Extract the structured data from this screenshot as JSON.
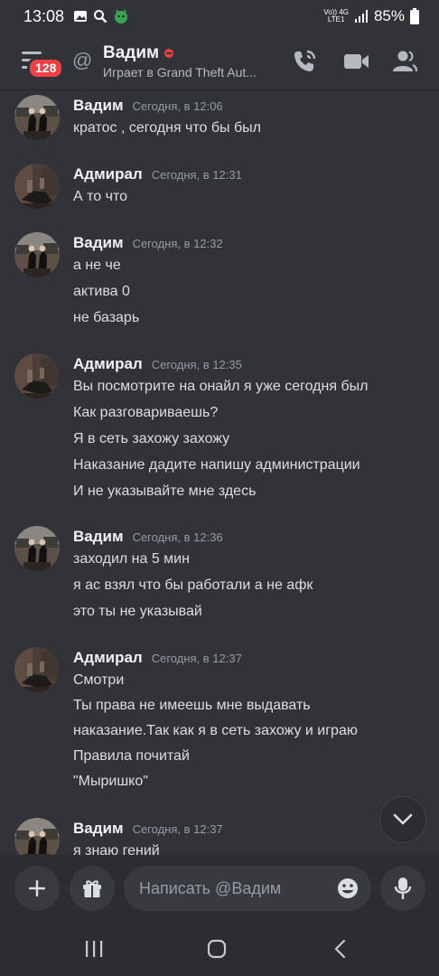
{
  "status_bar": {
    "time": "13:08",
    "network_top": "Vo)) 4G",
    "network_bottom": "LTE1",
    "battery": "85%"
  },
  "header": {
    "unread_badge": "128",
    "title": "Вадим",
    "activity": "Играет в Grand Theft Aut..."
  },
  "messages": [
    {
      "author": "Вадим",
      "timestamp": "Сегодня, в 12:06",
      "lines": [
        "кратос    , сегодня что бы был"
      ]
    },
    {
      "author": "Адмирал",
      "timestamp": "Сегодня, в 12:31",
      "lines": [
        "А то что"
      ]
    },
    {
      "author": "Вадим",
      "timestamp": "Сегодня, в 12:32",
      "lines": [
        "а не че",
        "актива 0",
        "не базарь"
      ]
    },
    {
      "author": "Адмирал",
      "timestamp": "Сегодня, в 12:35",
      "lines": [
        "Вы посмотрите на онайл я уже сегодня был",
        "Как разговариваешь?",
        "Я в сеть захожу захожу",
        "Наказание дадите напишу администрации",
        "И не указывайте мне здесь"
      ]
    },
    {
      "author": "Вадим",
      "timestamp": "Сегодня, в 12:36",
      "lines": [
        "заходил на 5 мин",
        "я ас взял что бы работали а не афк",
        "это ты не указывай"
      ]
    },
    {
      "author": "Адмирал",
      "timestamp": "Сегодня, в 12:37",
      "lines": [
        "Смотри",
        "Ты права не имеешь мне выдавать",
        "наказание.Так как я в сеть захожу и играю",
        "Правила почитай",
        "\"Мыришко\""
      ]
    },
    {
      "author": "Вадим",
      "timestamp": "Сегодня, в 12:37",
      "lines": [
        "я знаю гений"
      ]
    }
  ],
  "composer": {
    "placeholder": "Написать @Вадим"
  },
  "colors": {
    "background": "#313338",
    "composer_bg": "#2b2d31",
    "badge_red": "#f23f43"
  },
  "icons": [
    "menu-icon",
    "at-icon",
    "call-icon",
    "video-icon",
    "members-icon",
    "chevron-down-icon",
    "plus-icon",
    "gift-icon",
    "emoji-icon",
    "microphone-icon",
    "recents-icon",
    "home-icon",
    "back-icon"
  ]
}
